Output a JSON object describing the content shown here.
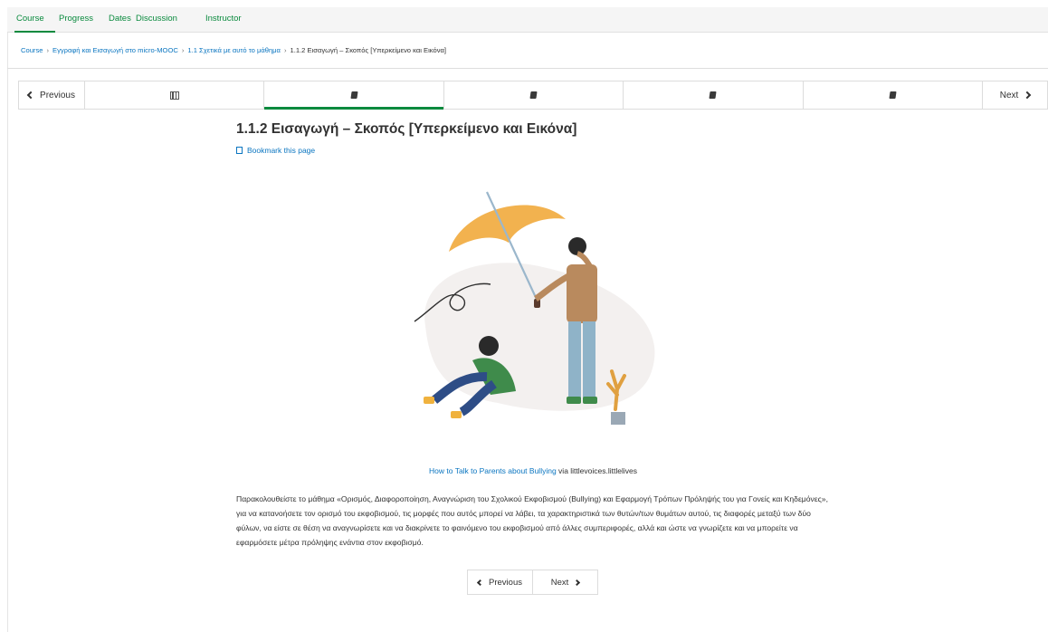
{
  "topnav": {
    "tabs": [
      "Course",
      "Progress",
      "Dates",
      "Discussion",
      "Instructor"
    ],
    "active": "Course"
  },
  "breadcrumb": {
    "items": [
      "Course",
      "Εγγραφή και Εισαγωγή στο micro-MOOC",
      "1.1 Σχετικά με αυτό το μάθημα"
    ],
    "current": "1.1.2 Εισαγωγή – Σκοπός [Υπερκείμενο και Εικόνα]"
  },
  "sequence": {
    "prev_label": "Previous",
    "next_label": "Next",
    "units": [
      {
        "icon": "video-icon"
      },
      {
        "icon": "book-icon"
      },
      {
        "icon": "book-icon"
      },
      {
        "icon": "book-icon"
      },
      {
        "icon": "book-icon"
      }
    ],
    "active_index": 1
  },
  "page": {
    "title": "1.1.2 Εισαγωγή – Σκοπός [Υπερκείμενο και Εικόνα]",
    "bookmark": "Bookmark this page"
  },
  "caption": {
    "link": "How to Talk to Parents about Bullying",
    "via": " via littlevoices.littlelives"
  },
  "body": {
    "text": "Παρακολουθείστε το μάθημα «Ορισμός, Διαφοροποίηση, Αναγνώριση του Σχολικού Εκφοβισμού (Bullying) και Εφαρμογή Τρόπων Πρόληψής του για Γονείς και Κηδεμόνες», για να κατανοήσετε τον ορισμό του εκφοβισμού, τις μορφές που αυτός μπορεί να λάβει, τα χαρακτηριστικά των θυτών/των θυμάτων αυτού, τις διαφορές μεταξύ των δύο φύλων, να είστε σε θέση να αναγνωρίσετε και να διακρίνετε το φαινόμενο του εκφοβισμού από άλλες συμπεριφορές, αλλά και ώστε να γνωρίζετε και να μπορείτε να εφαρμόσετε μέτρα πρόληψης ενάντια στον εκφοβισμό."
  },
  "bottom_nav": {
    "prev_label": "Previous",
    "next_label": "Next"
  },
  "colors": {
    "accent": "#0a8a3e",
    "link": "#0a75c0"
  }
}
